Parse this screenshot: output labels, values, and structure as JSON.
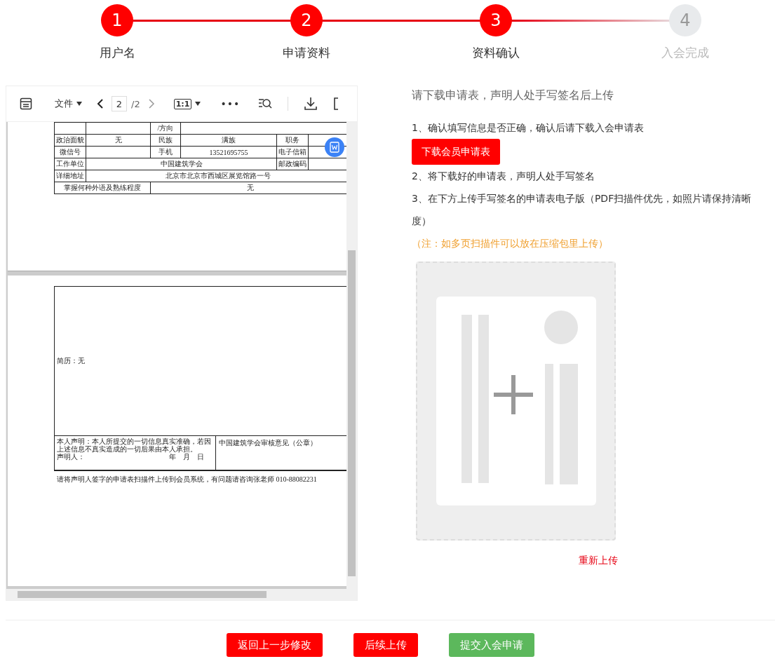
{
  "steps": [
    {
      "number": "1",
      "label": "用户名",
      "done": true
    },
    {
      "number": "2",
      "label": "申请资料",
      "done": true
    },
    {
      "number": "3",
      "label": "资料确认",
      "done": true
    },
    {
      "number": "4",
      "label": "入会完成",
      "done": false
    }
  ],
  "viewer": {
    "file_menu": "文件",
    "page": "2",
    "page_total": "/2",
    "zoom": "1:1",
    "more": "•••",
    "table_rows": [
      {
        "kind": "tail",
        "cells": [
          "",
          "",
          "/方向",
          ""
        ]
      },
      {
        "kind": "full",
        "cells": [
          "政治面貌",
          "无",
          "民族",
          "满族",
          "职务",
          ""
        ]
      },
      {
        "kind": "full",
        "cells": [
          "微信号",
          "",
          "手机",
          "13521695755",
          "电子信箱",
          ""
        ]
      },
      {
        "kind": "merged",
        "cells": [
          "工作单位",
          "中国建筑学会",
          "邮政编码",
          ""
        ]
      },
      {
        "kind": "wide",
        "cells": [
          "详细地址",
          "北京市北京市西城区展览馆路一号"
        ]
      },
      {
        "kind": "split",
        "cells": [
          "掌握何种外语及熟练程度",
          "无"
        ]
      }
    ],
    "resume": "简历：无",
    "declaration": "本人声明：本人所提交的一切信息真实准确，若因上述信息不真实造成的一切后果由本人承担。",
    "signer": "声明人：",
    "date": "年　月　日",
    "review": "中国建筑学会审核意见（公章）",
    "footnote": "请将声明人签字的申请表扫描件上传到会员系统，有问题请咨询张老师 010-88082231"
  },
  "panel": {
    "title": "请下载申请表，声明人处手写签名后上传",
    "items": [
      {
        "kind": "text",
        "text": "1、确认填写信息是否正确，确认后请下载入会申请表"
      },
      {
        "kind": "button",
        "text": "下载会员申请表"
      },
      {
        "kind": "text",
        "text": "2、将下载好的申请表，声明人处手写签名"
      },
      {
        "kind": "text",
        "text": "3、在下方上传手写签名的申请表电子版（PDF扫描件优先，如照片请保持清晰度）"
      },
      {
        "kind": "note",
        "text": "（注：如多页扫描件可以放在压缩包里上传）"
      }
    ],
    "reupload": "重新上传"
  },
  "buttons": [
    {
      "label": "返回上一步修改",
      "kind": "danger"
    },
    {
      "label": "后续上传",
      "kind": "danger"
    },
    {
      "label": "提交入会申请",
      "kind": "success"
    }
  ]
}
